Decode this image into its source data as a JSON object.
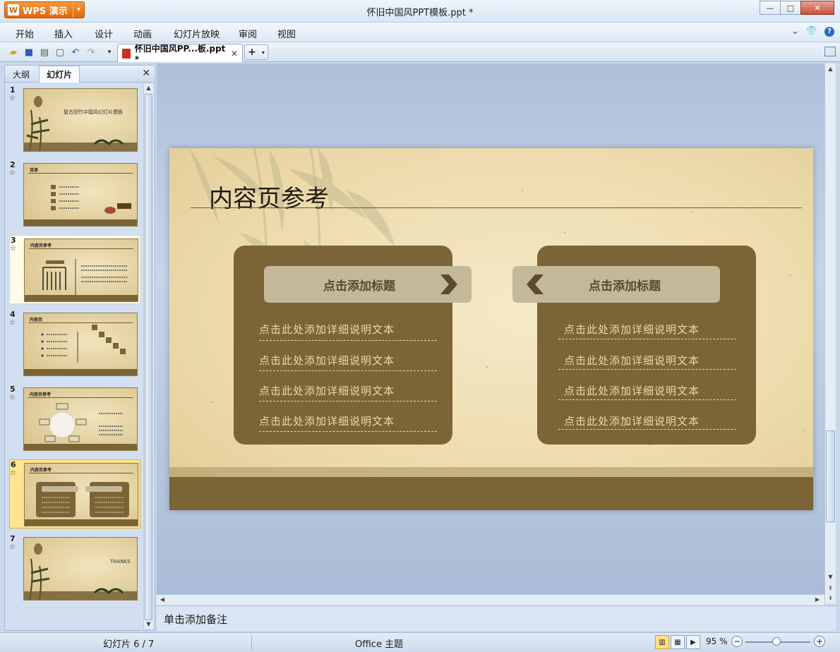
{
  "window": {
    "app_button": "WPS 演示",
    "title": "怀旧中国风PPT模板.ppt *",
    "controls": {
      "minimize": "—",
      "maximize": "□",
      "close": "✕"
    }
  },
  "menu": {
    "items": [
      "开始",
      "插入",
      "设计",
      "动画",
      "幻灯片放映",
      "审阅",
      "视图"
    ],
    "right": {
      "collapse": "⌄",
      "skin": "👕",
      "help": "?"
    }
  },
  "toolbar": {
    "doc_tab": "怀旧中国风PP...板.ppt *",
    "doc_tab_close": "✕",
    "new_tab": "+",
    "new_tab_arrow": "▾"
  },
  "left_panel": {
    "tabs": [
      "大纲",
      "幻灯片"
    ],
    "close": "✕",
    "selected_index": 6,
    "slides": [
      {
        "num": "1",
        "star": "☆",
        "text": "复古田竹中国风幻灯片模板"
      },
      {
        "num": "2",
        "star": "☆",
        "text": "目录"
      },
      {
        "num": "3",
        "star": "☆",
        "text": "内容页参考"
      },
      {
        "num": "4",
        "star": "☆",
        "text": "内容页"
      },
      {
        "num": "5",
        "star": "☆",
        "text": "内容页参考"
      },
      {
        "num": "6",
        "star": "☆",
        "text": "内容页参考"
      },
      {
        "num": "7",
        "star": "☆",
        "text": "THANKS"
      }
    ]
  },
  "slide": {
    "title": "内容页参考",
    "left_panel": {
      "heading": "点击添加标题",
      "items": [
        "点击此处添加详细说明文本",
        "点击此处添加详细说明文本",
        "点击此处添加详细说明文本",
        "点击此处添加详细说明文本"
      ]
    },
    "right_panel": {
      "heading": "点击添加标题",
      "items": [
        "点击此处添加详细说明文本",
        "点击此处添加详细说明文本",
        "点击此处添加详细说明文本",
        "点击此处添加详细说明文本"
      ]
    },
    "colors": {
      "panel": "#7b6537",
      "heading_bg": "#c3b999",
      "paper": "#eedcae"
    }
  },
  "notes": {
    "placeholder": "单击添加备注"
  },
  "status": {
    "slide_counter": "幻灯片 6 / 7",
    "theme": "Office 主题",
    "zoom": "95 %",
    "zoom_minus": "−",
    "zoom_plus": "+"
  }
}
